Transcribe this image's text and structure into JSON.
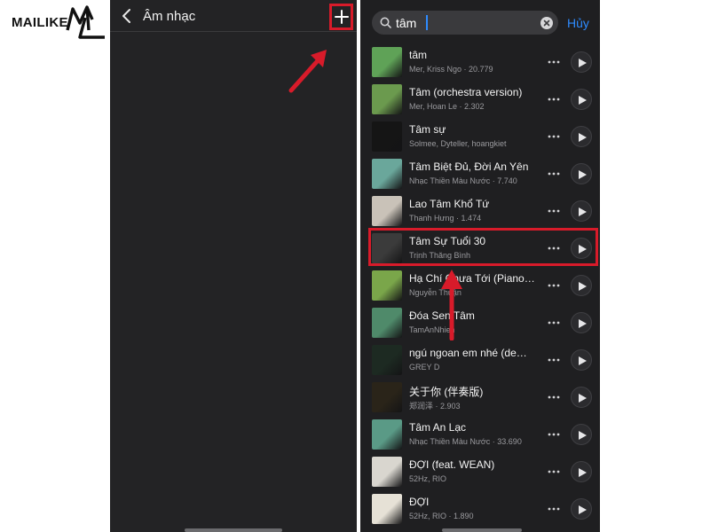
{
  "watermark": {
    "brand": "MAILIKE",
    "icon": "ml-monogram-logo"
  },
  "left_screen": {
    "back_icon": "chevron-left-icon",
    "title": "Âm nhạc",
    "add_icon": "plus-icon"
  },
  "right_screen": {
    "search": {
      "value": "tâm",
      "search_icon": "magnifier-icon",
      "clear_icon": "clear-x-icon"
    },
    "cancel_label": "Hủy",
    "songs": [
      {
        "title": "tâm",
        "meta": "Mer, Kriss Ngo · 20.779",
        "thumb_color": "#5fa257"
      },
      {
        "title": "Tâm (orchestra version)",
        "meta": "Mer, Hoan Le · 2.302",
        "thumb_color": "#6b9a4e"
      },
      {
        "title": "Tâm sự",
        "meta": "Solmee, Dyteller, hoangkiet",
        "thumb_color": "#151515"
      },
      {
        "title": "Tâm Biệt Đủ, Đời An Yên",
        "meta": "Nhạc Thiền Màu Nước · 7.740",
        "thumb_color": "#6aa79b"
      },
      {
        "title": "Lao Tâm Khổ Tứ",
        "meta": "Thanh Hưng · 1.474",
        "thumb_color": "#c9c2b8"
      },
      {
        "title": "Tâm Sự Tuổi 30",
        "meta": "Trịnh Thăng Bình",
        "thumb_color": "#3b3b3b"
      },
      {
        "title": "Hạ Chí Chưa Tới (Piano…",
        "meta": "Nguyễn Thuận",
        "thumb_color": "#7aa64a"
      },
      {
        "title": "Đóa Sen Tâm",
        "meta": "TamAnNhien",
        "thumb_color": "#4f8a6a"
      },
      {
        "title": "ngú ngoan em nhé (de…",
        "meta": "GREY D",
        "thumb_color": "#1d2a22"
      },
      {
        "title": "关于你 (伴奏版)",
        "meta": "郑润泽 · 2.903",
        "thumb_color": "#2a2419"
      },
      {
        "title": "Tâm An Lạc",
        "meta": "Nhạc Thiền Màu Nước · 33.690",
        "thumb_color": "#5a9a86"
      },
      {
        "title": "ĐỢI (feat. WEAN)",
        "meta": "52Hz, RIO",
        "thumb_color": "#d9d6cf"
      },
      {
        "title": "ĐỢI",
        "meta": "52Hz, RIO · 1.890",
        "thumb_color": "#e6e1d6"
      }
    ],
    "more_icon": "ellipsis-icon",
    "play_icon": "play-icon"
  },
  "annotations": {
    "highlight_color": "#d81b2a",
    "arrows": [
      "arrow-to-add-button",
      "arrow-to-highlighted-song"
    ]
  }
}
